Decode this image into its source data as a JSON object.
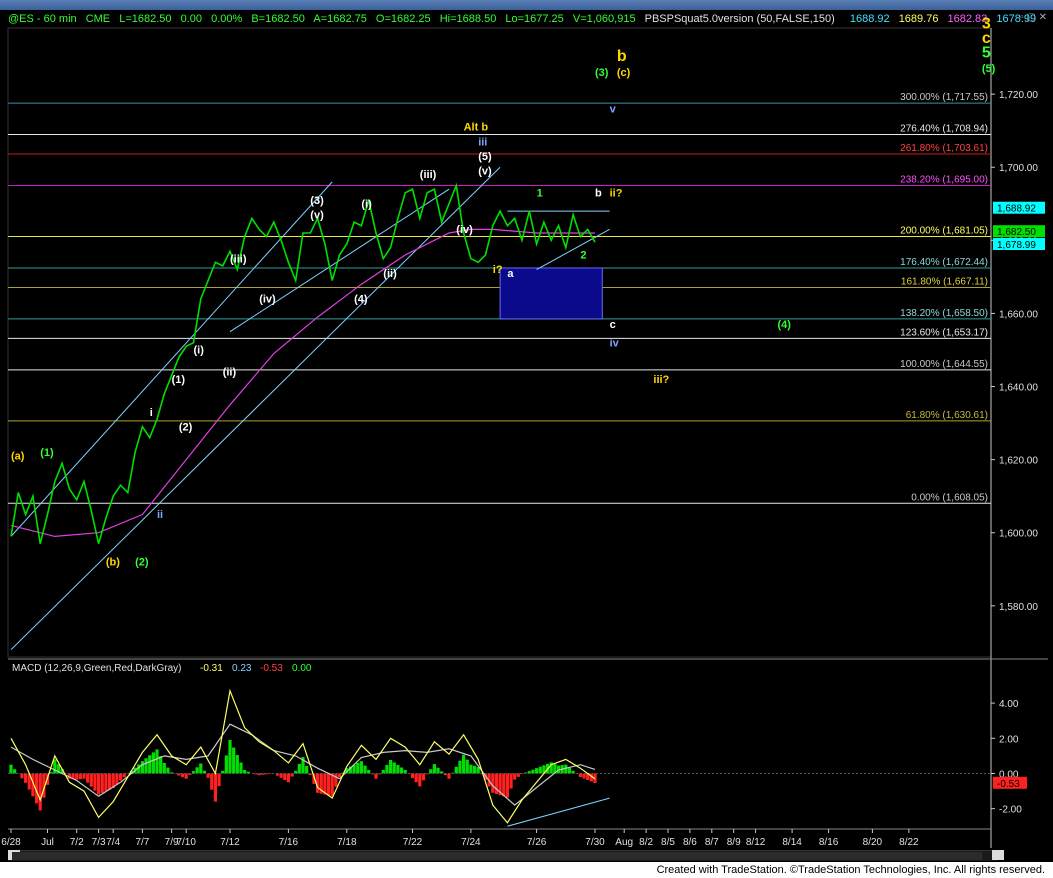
{
  "window": {
    "header": {
      "symbol": "@ES - 60 min",
      "exchange": "CME",
      "last": "L=1682.50",
      "change": "0.00",
      "pct": "0.00%",
      "bid": "B=1682.50",
      "ask": "A=1682.75",
      "open": "O=1682.25",
      "high": "Hi=1688.50",
      "low": "Lo=1677.25",
      "volume": "V=1,060,915",
      "study": "PBSPSquat5.0version (50,FALSE,150)",
      "study_vals": [
        "1688.92",
        "1689.76",
        "1682.83",
        "1678.99"
      ]
    },
    "footer": "Created with TradeStation. ©TradeStation Technologies, Inc. All rights reserved."
  },
  "colors": {
    "price": "#00e000",
    "ma_magenta": "#e040e0",
    "channel": "#7fd4ff",
    "macd": "#ffff66",
    "signal": "#c8c8c8",
    "hist_pos": "#00e000",
    "hist_neg": "#ff2020",
    "yellow_label": "#ffd700",
    "green_label": "#33ff33",
    "blue_label": "#7fa7ff"
  },
  "chart_data": [
    {
      "type": "line",
      "title": "@ES - 60 min",
      "ylim": [
        1566,
        1737
      ],
      "y_ticks": [
        "1,720.00",
        "1,700.00",
        "1,680.00",
        "1,660.00",
        "1,640.00",
        "1,620.00",
        "1,600.00",
        "1,580.00"
      ],
      "y_tick_values": [
        1720,
        1700,
        1680,
        1660,
        1640,
        1620,
        1600,
        1580
      ],
      "x_ticks": [
        "6/28",
        "Jul",
        "7/2",
        "7/3",
        "7/4",
        "7/7",
        "7/9",
        "7/10",
        "7/12",
        "7/16",
        "7/18",
        "7/22",
        "7/24",
        "7/26",
        "7/30",
        "Aug",
        "8/2",
        "8/5",
        "8/6",
        "8/7",
        "8/9",
        "8/12",
        "8/14",
        "8/16",
        "8/20",
        "8/22"
      ],
      "x_tick_slots": [
        0,
        5,
        9,
        12,
        14,
        18,
        22,
        24,
        30,
        38,
        46,
        55,
        63,
        72,
        80,
        84,
        87,
        90,
        93,
        96,
        99,
        102,
        107,
        112,
        118,
        123
      ],
      "price_path": [
        [
          0,
          1599
        ],
        [
          1,
          1611
        ],
        [
          2,
          1605
        ],
        [
          3,
          1610
        ],
        [
          4,
          1597
        ],
        [
          5,
          1605
        ],
        [
          6,
          1614
        ],
        [
          7,
          1619
        ],
        [
          8,
          1612
        ],
        [
          9,
          1609
        ],
        [
          10,
          1614
        ],
        [
          11,
          1606
        ],
        [
          12,
          1597
        ],
        [
          13,
          1604
        ],
        [
          14,
          1610
        ],
        [
          15,
          1613
        ],
        [
          16,
          1611
        ],
        [
          17,
          1622
        ],
        [
          18,
          1629
        ],
        [
          19,
          1626
        ],
        [
          20,
          1631
        ],
        [
          21,
          1638
        ],
        [
          22,
          1643
        ],
        [
          23,
          1648
        ],
        [
          24,
          1651
        ],
        [
          25,
          1652
        ],
        [
          26,
          1664
        ],
        [
          27,
          1669
        ],
        [
          28,
          1674
        ],
        [
          29,
          1673
        ],
        [
          30,
          1677
        ],
        [
          31,
          1672
        ],
        [
          32,
          1681
        ],
        [
          33,
          1686
        ],
        [
          34,
          1683
        ],
        [
          35,
          1681
        ],
        [
          36,
          1685
        ],
        [
          37,
          1680
        ],
        [
          38,
          1674
        ],
        [
          39,
          1669
        ],
        [
          40,
          1682
        ],
        [
          41,
          1682
        ],
        [
          42,
          1686
        ],
        [
          43,
          1679
        ],
        [
          44,
          1669
        ],
        [
          45,
          1676
        ],
        [
          46,
          1679
        ],
        [
          47,
          1685
        ],
        [
          48,
          1684
        ],
        [
          49,
          1691
        ],
        [
          50,
          1682
        ],
        [
          51,
          1675
        ],
        [
          52,
          1678
        ],
        [
          53,
          1686
        ],
        [
          54,
          1693
        ],
        [
          55,
          1694
        ],
        [
          56,
          1686
        ],
        [
          57,
          1693
        ],
        [
          58,
          1694
        ],
        [
          59,
          1685
        ],
        [
          60,
          1690
        ],
        [
          61,
          1695
        ],
        [
          62,
          1682
        ],
        [
          63,
          1675
        ],
        [
          64,
          1674
        ],
        [
          65,
          1676
        ],
        [
          66,
          1684
        ],
        [
          67,
          1688
        ],
        [
          68,
          1684
        ],
        [
          69,
          1686
        ],
        [
          70,
          1680
        ],
        [
          71,
          1688
        ],
        [
          72,
          1679
        ],
        [
          73,
          1685
        ],
        [
          74,
          1680
        ],
        [
          75,
          1684
        ],
        [
          76,
          1678
        ],
        [
          77,
          1687
        ],
        [
          78,
          1681
        ],
        [
          79,
          1683
        ],
        [
          80,
          1679.5
        ]
      ],
      "magenta_ma": [
        [
          0,
          1602
        ],
        [
          6,
          1599
        ],
        [
          12,
          1600
        ],
        [
          18,
          1605
        ],
        [
          24,
          1620
        ],
        [
          30,
          1635
        ],
        [
          36,
          1649
        ],
        [
          42,
          1659
        ],
        [
          48,
          1668
        ],
        [
          54,
          1676
        ],
        [
          60,
          1682
        ],
        [
          63,
          1683
        ],
        [
          66,
          1683
        ],
        [
          72,
          1682
        ],
        [
          78,
          1682
        ],
        [
          80,
          1682
        ]
      ],
      "channel_lines": [
        {
          "from": [
            0,
            1568
          ],
          "to": [
            67,
            1700
          ]
        },
        {
          "from": [
            0,
            1599
          ],
          "to": [
            44,
            1696
          ]
        },
        {
          "from": [
            30,
            1655
          ],
          "to": [
            60,
            1694
          ]
        },
        {
          "from": [
            72,
            1672
          ],
          "to": [
            82,
            1683
          ]
        },
        {
          "from": [
            68,
            1688
          ],
          "to": [
            82,
            1688
          ]
        }
      ],
      "fib_levels": [
        {
          "label": "300.00% (1,717.55)",
          "value": 1717.55,
          "color": "#3b8fa8",
          "text": "#c8c8c8"
        },
        {
          "label": "276.40% (1,708.94)",
          "value": 1708.94,
          "color": "#e8e8e8",
          "text": "#e8e8e8"
        },
        {
          "label": "261.80% (1,703.61)",
          "value": 1703.61,
          "color": "#c81e1e",
          "text": "#ff4040"
        },
        {
          "label": "238.20% (1,695.00)",
          "value": 1695.0,
          "color": "#c81ec8",
          "text": "#ff50ff"
        },
        {
          "label": "200.00% (1,681.05)",
          "value": 1681.05,
          "color": "#e8e840",
          "text": "#ffff60"
        },
        {
          "label": "176.40% (1,672.44)",
          "value": 1672.44,
          "color": "#2fa0a0",
          "text": "#8fd8d8"
        },
        {
          "label": "161.80% (1,667.11)",
          "value": 1667.11,
          "color": "#b0a030",
          "text": "#e0d040"
        },
        {
          "label": "138.20% (1,658.50)",
          "value": 1658.5,
          "color": "#2fa0a0",
          "text": "#8fd8d8"
        },
        {
          "label": "123.60% (1,653.17)",
          "value": 1653.17,
          "color": "#e8e8e8",
          "text": "#e8e8e8"
        },
        {
          "label": "100.00% (1,644.55)",
          "value": 1644.55,
          "color": "#e8e8e8",
          "text": "#c8c8c8"
        },
        {
          "label": "61.80% (1,630.61)",
          "value": 1630.61,
          "color": "#b0a030",
          "text": "#c8b840"
        },
        {
          "label": "0.00% (1,608.05)",
          "value": 1608.05,
          "color": "#e8e8e8",
          "text": "#c8c8c8"
        }
      ],
      "target_box": {
        "x0": 67,
        "x1": 81,
        "y0": 1658.5,
        "y1": 1672.44
      },
      "price_flags": [
        {
          "value": "1,688.92",
          "y": 1688.92,
          "bg": "#00ffff",
          "fg": "#000"
        },
        {
          "value": "1,682.50",
          "y": 1682.5,
          "bg": "#00e000",
          "fg": "#000"
        },
        {
          "value": "1,678.99",
          "y": 1678.99,
          "bg": "#00ffff",
          "fg": "#000"
        }
      ],
      "wave_labels": [
        {
          "t": "(a)",
          "x": 0,
          "y": 1620,
          "c": "#ffd700"
        },
        {
          "t": "(1)",
          "x": 4,
          "y": 1621,
          "c": "#33ff33"
        },
        {
          "t": "(b)",
          "x": 13,
          "y": 1591,
          "c": "#ffd700"
        },
        {
          "t": "(2)",
          "x": 17,
          "y": 1591,
          "c": "#33ff33"
        },
        {
          "t": "ii",
          "x": 20,
          "y": 1604,
          "c": "#7fa7ff"
        },
        {
          "t": "i",
          "x": 19,
          "y": 1632,
          "c": "#ffffff"
        },
        {
          "t": "(1)",
          "x": 22,
          "y": 1641,
          "c": "#ffffff"
        },
        {
          "t": "(2)",
          "x": 23,
          "y": 1628,
          "c": "#ffffff"
        },
        {
          "t": "(i)",
          "x": 25,
          "y": 1649,
          "c": "#ffffff"
        },
        {
          "t": "(ii)",
          "x": 29,
          "y": 1643,
          "c": "#ffffff"
        },
        {
          "t": "(iii)",
          "x": 30,
          "y": 1674,
          "c": "#ffffff"
        },
        {
          "t": "(iv)",
          "x": 34,
          "y": 1663,
          "c": "#ffffff"
        },
        {
          "t": "(3)",
          "x": 41,
          "y": 1690,
          "c": "#ffffff"
        },
        {
          "t": "(v)",
          "x": 41,
          "y": 1686,
          "c": "#ffffff"
        },
        {
          "t": "(i)",
          "x": 48,
          "y": 1689,
          "c": "#ffffff"
        },
        {
          "t": "(4)",
          "x": 47,
          "y": 1663,
          "c": "#ffffff"
        },
        {
          "t": "(ii)",
          "x": 51,
          "y": 1670,
          "c": "#ffffff"
        },
        {
          "t": "(iii)",
          "x": 56,
          "y": 1697,
          "c": "#ffffff"
        },
        {
          "t": "(iv)",
          "x": 61,
          "y": 1682,
          "c": "#ffffff"
        },
        {
          "t": "(v)",
          "x": 64,
          "y": 1698,
          "c": "#ffffff"
        },
        {
          "t": "(5)",
          "x": 64,
          "y": 1702,
          "c": "#ffffff"
        },
        {
          "t": "iii",
          "x": 64,
          "y": 1706,
          "c": "#7fa7ff"
        },
        {
          "t": "Alt b",
          "x": 62,
          "y": 1710,
          "c": "#ffd700"
        },
        {
          "t": "i?",
          "x": 66,
          "y": 1671,
          "c": "#ffd700"
        },
        {
          "t": "a",
          "x": 68,
          "y": 1670,
          "c": "#ffffff"
        },
        {
          "t": "1",
          "x": 72,
          "y": 1692,
          "c": "#33ff33"
        },
        {
          "t": "b",
          "x": 80,
          "y": 1692,
          "c": "#ffffff"
        },
        {
          "t": "ii?",
          "x": 82,
          "y": 1692,
          "c": "#ffd700"
        },
        {
          "t": "2",
          "x": 78,
          "y": 1675,
          "c": "#33ff33"
        },
        {
          "t": "c",
          "x": 82,
          "y": 1656,
          "c": "#ffffff"
        },
        {
          "t": "iv",
          "x": 82,
          "y": 1651,
          "c": "#7fa7ff"
        },
        {
          "t": "iii?",
          "x": 88,
          "y": 1641,
          "c": "#ffd700"
        },
        {
          "t": "(4)",
          "x": 105,
          "y": 1656,
          "c": "#33ff33"
        },
        {
          "t": "v",
          "x": 82,
          "y": 1715,
          "c": "#7fa7ff"
        },
        {
          "t": "(3)",
          "x": 80,
          "y": 1725,
          "c": "#33ff33"
        },
        {
          "t": "(c)",
          "x": 83,
          "y": 1725,
          "c": "#ffd700"
        },
        {
          "t": "b",
          "x": 83,
          "y": 1729,
          "c": "#ffd700"
        },
        {
          "t": "3",
          "x": 133,
          "y": 1738,
          "c": "#ffd700"
        },
        {
          "t": "c",
          "x": 133,
          "y": 1734,
          "c": "#ffd700"
        },
        {
          "t": "5",
          "x": 133,
          "y": 1730,
          "c": "#33ff33"
        },
        {
          "t": "(5)",
          "x": 133,
          "y": 1726,
          "c": "#33ff33"
        }
      ]
    },
    {
      "type": "bar",
      "title": "MACD (12,26,9,Green,Red,DarkGray)",
      "values_text": [
        "-0.31",
        "0.23",
        "-0.53",
        "0.00"
      ],
      "ylim": [
        -3.1,
        5.2
      ],
      "y_ticks": [
        "4.00",
        "2.00",
        "0.00",
        "-2.00"
      ],
      "y_tick_values": [
        4,
        2,
        0,
        -2
      ],
      "last_flag": "-0.53",
      "macd_path": [
        [
          0,
          2
        ],
        [
          2,
          0.5
        ],
        [
          4,
          -1.5
        ],
        [
          6,
          1.0
        ],
        [
          8,
          -0.5
        ],
        [
          10,
          -1.0
        ],
        [
          12,
          -2.5
        ],
        [
          14,
          -1.6
        ],
        [
          16,
          -0.2
        ],
        [
          18,
          1.2
        ],
        [
          20,
          2.2
        ],
        [
          22,
          1.0
        ],
        [
          24,
          0.5
        ],
        [
          26,
          1.5
        ],
        [
          28,
          0.0
        ],
        [
          30,
          4.7
        ],
        [
          32,
          2.6
        ],
        [
          34,
          1.8
        ],
        [
          36,
          1.3
        ],
        [
          38,
          0.6
        ],
        [
          40,
          1.7
        ],
        [
          42,
          -0.8
        ],
        [
          44,
          -1.4
        ],
        [
          46,
          0.4
        ],
        [
          48,
          1.6
        ],
        [
          50,
          0.8
        ],
        [
          52,
          2.0
        ],
        [
          54,
          1.5
        ],
        [
          56,
          0.5
        ],
        [
          58,
          1.8
        ],
        [
          60,
          1.1
        ],
        [
          62,
          2.2
        ],
        [
          64,
          0.8
        ],
        [
          66,
          -1.8
        ],
        [
          68,
          -2.8
        ],
        [
          70,
          -1.5
        ],
        [
          72,
          -0.5
        ],
        [
          74,
          0.5
        ],
        [
          76,
          0.8
        ],
        [
          78,
          0.3
        ],
        [
          80,
          -0.31
        ]
      ],
      "signal_path": [
        [
          0,
          1.5
        ],
        [
          3,
          0.8
        ],
        [
          6,
          0.2
        ],
        [
          9,
          -0.4
        ],
        [
          12,
          -1.3
        ],
        [
          15,
          -0.5
        ],
        [
          18,
          0.5
        ],
        [
          21,
          1.0
        ],
        [
          24,
          0.8
        ],
        [
          27,
          1.0
        ],
        [
          30,
          2.8
        ],
        [
          33,
          2.2
        ],
        [
          36,
          1.3
        ],
        [
          39,
          1.0
        ],
        [
          42,
          0.3
        ],
        [
          45,
          -0.3
        ],
        [
          48,
          0.9
        ],
        [
          51,
          1.2
        ],
        [
          54,
          1.3
        ],
        [
          57,
          1.2
        ],
        [
          60,
          1.4
        ],
        [
          63,
          1.0
        ],
        [
          66,
          -0.7
        ],
        [
          69,
          -1.8
        ],
        [
          72,
          -0.8
        ],
        [
          75,
          0.2
        ],
        [
          78,
          0.5
        ],
        [
          80,
          0.23
        ]
      ],
      "support_line": {
        "from": [
          68,
          -3.0
        ],
        "to": [
          82,
          -1.4
        ]
      }
    }
  ]
}
